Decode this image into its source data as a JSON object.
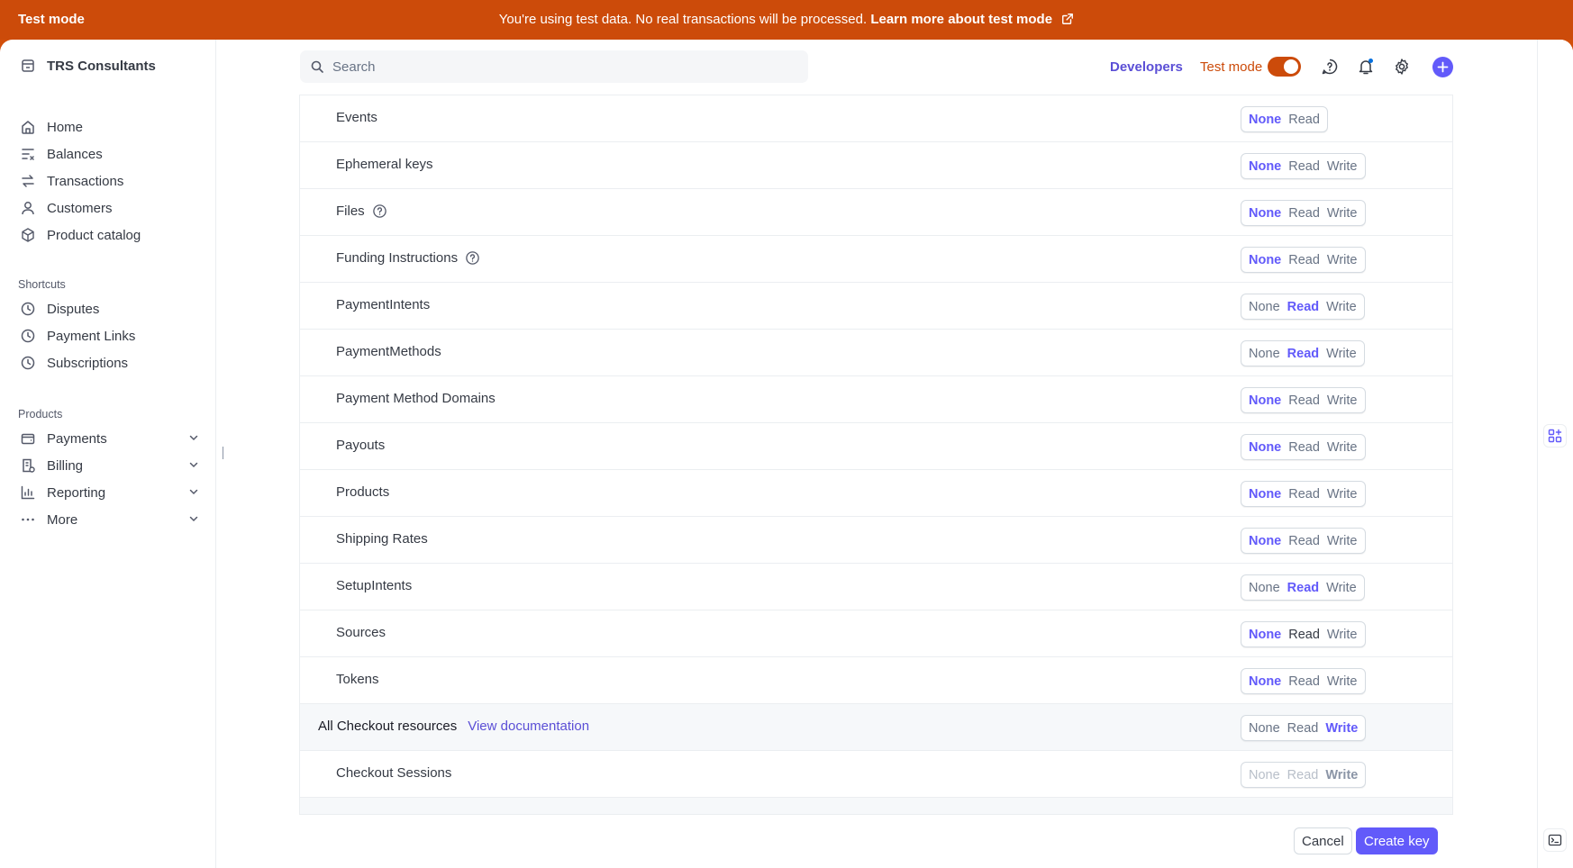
{
  "banner": {
    "mode_label": "Test mode",
    "message": "You're using test data. No real transactions will be processed.",
    "link": "Learn more about test mode"
  },
  "sidebar": {
    "account": "TRS Consultants",
    "main_items": [
      {
        "label": "Home",
        "icon": "home-icon"
      },
      {
        "label": "Balances",
        "icon": "balances-icon"
      },
      {
        "label": "Transactions",
        "icon": "transactions-icon"
      },
      {
        "label": "Customers",
        "icon": "customer-icon"
      },
      {
        "label": "Product catalog",
        "icon": "box-icon"
      }
    ],
    "shortcuts_title": "Shortcuts",
    "shortcuts": [
      {
        "label": "Disputes",
        "icon": "clock-icon"
      },
      {
        "label": "Payment Links",
        "icon": "clock-icon"
      },
      {
        "label": "Subscriptions",
        "icon": "clock-icon"
      }
    ],
    "products_title": "Products",
    "products": [
      {
        "label": "Payments",
        "icon": "wallet-icon"
      },
      {
        "label": "Billing",
        "icon": "billing-icon"
      },
      {
        "label": "Reporting",
        "icon": "chart-icon"
      },
      {
        "label": "More",
        "icon": "ellipsis-icon"
      }
    ]
  },
  "topbar": {
    "search_placeholder": "Search",
    "developers": "Developers",
    "test_mode": "Test mode",
    "test_mode_on": true
  },
  "permissions": {
    "options": [
      "None",
      "Read",
      "Write"
    ],
    "rows": [
      {
        "label": "Events",
        "options": [
          "None",
          "Read"
        ],
        "selected": "None",
        "help": false
      },
      {
        "label": "Ephemeral keys",
        "selected": "None",
        "help": false
      },
      {
        "label": "Files",
        "selected": "None",
        "help": true
      },
      {
        "label": "Funding Instructions",
        "selected": "None",
        "help": true
      },
      {
        "label": "PaymentIntents",
        "selected": "Read",
        "help": false
      },
      {
        "label": "PaymentMethods",
        "selected": "Read",
        "help": false
      },
      {
        "label": "Payment Method Domains",
        "selected": "None",
        "help": false
      },
      {
        "label": "Payouts",
        "selected": "None",
        "help": false
      },
      {
        "label": "Products",
        "selected": "None",
        "help": false
      },
      {
        "label": "Shipping Rates",
        "selected": "None",
        "help": false
      },
      {
        "label": "SetupIntents",
        "selected": "Read",
        "help": false
      },
      {
        "label": "Sources",
        "selected": "None",
        "help": false
      },
      {
        "label": "Tokens",
        "selected": "None",
        "help": false
      },
      {
        "label": "All Checkout resources",
        "selected": "Write",
        "group": true,
        "link": "View documentation"
      },
      {
        "label": "Checkout Sessions",
        "selected": "Write",
        "disabled": true
      }
    ]
  },
  "footer": {
    "cancel": "Cancel",
    "create": "Create key"
  },
  "colors": {
    "accent": "#625afa",
    "test_mode": "#cc4b0a"
  }
}
